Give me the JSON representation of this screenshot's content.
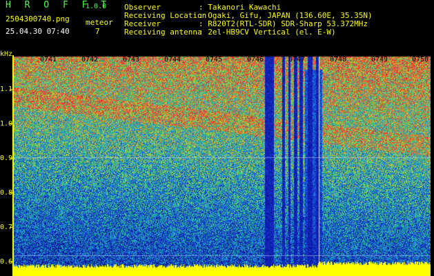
{
  "header": {
    "brand": "H R O F F T",
    "version": "1.0.0",
    "filename": "2504300740.png",
    "timestamp": "25.04.30 07:40",
    "meteor_label": "meteor",
    "meteor_count": "7"
  },
  "info": [
    {
      "label": "Observer",
      "value": ": Takanori Kawachi"
    },
    {
      "label": "Receiving Location",
      "value": ": Ogaki, Gifu, JAPAN (136.60E, 35.35N)"
    },
    {
      "label": "Receiver",
      "value": ": R820T2(RTL-SDR) SDR-Sharp 53.372MHz"
    },
    {
      "label": "Receiving antenna",
      "value": ": 2el-HB9CV Vertical (el. E-W)"
    }
  ],
  "axis": {
    "y_unit": "kHz",
    "y_ticks": [
      "1.1",
      "1.0",
      "0.9",
      "0.8",
      "0.7",
      "0.6"
    ],
    "x_ticks": [
      "0741",
      "0742",
      "0743",
      "0744",
      "0745",
      "0746",
      "0747",
      "0748",
      "0749",
      "0750"
    ]
  },
  "colors": {
    "text_yellow": "#ffff00",
    "text_green": "#44ff44",
    "background": "#000000",
    "low_signal": "#1020c0",
    "high_signal": "#ff3030"
  }
}
